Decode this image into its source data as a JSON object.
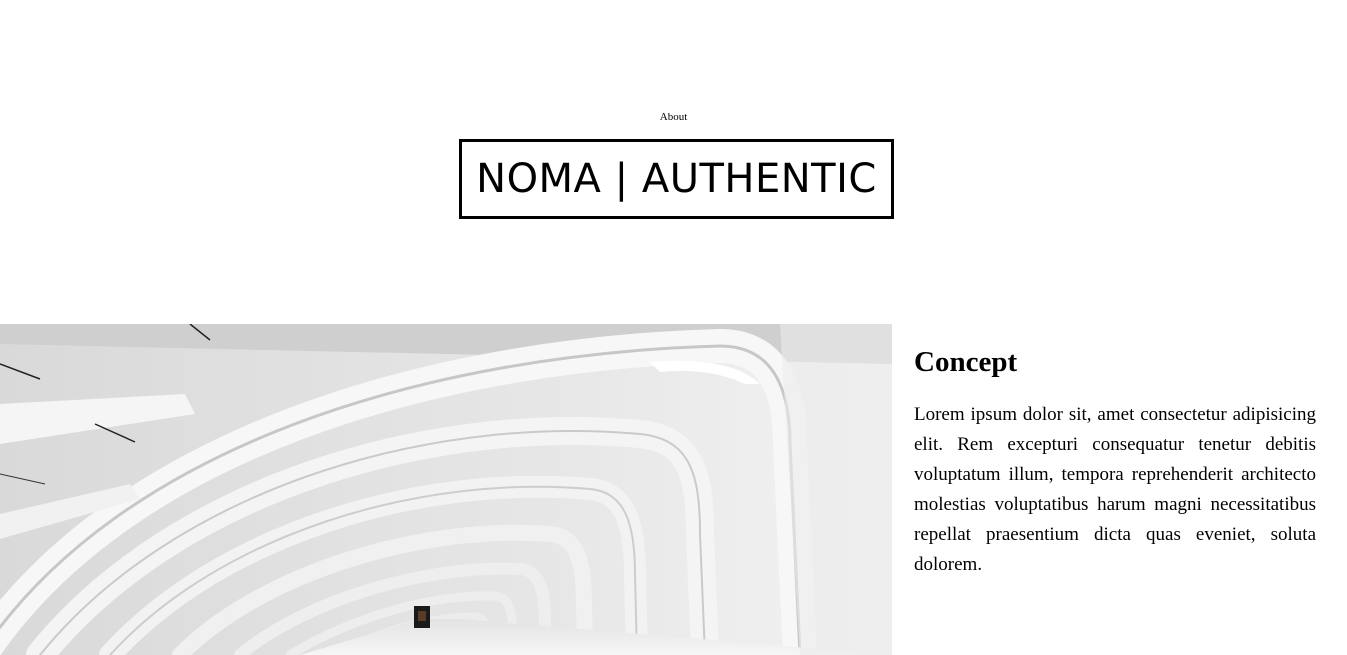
{
  "nav": {
    "about_label": "About"
  },
  "brand": {
    "logo_text": "NOMA | AUTHENTIC"
  },
  "hero": {
    "image_alt": "White arched architectural corridor"
  },
  "concept": {
    "heading": "Concept",
    "body": "Lorem ipsum dolor sit, amet consectetur adipisicing elit. Rem excepturi consequatur tenetur debitis voluptatum illum, tempora reprehenderit architecto molestias voluptatibus harum magni necessitatibus repellat praesentium dicta quas eveniet, soluta dolorem."
  },
  "colors": {
    "background": "#ffffff",
    "text": "#000000",
    "border": "#000000"
  }
}
